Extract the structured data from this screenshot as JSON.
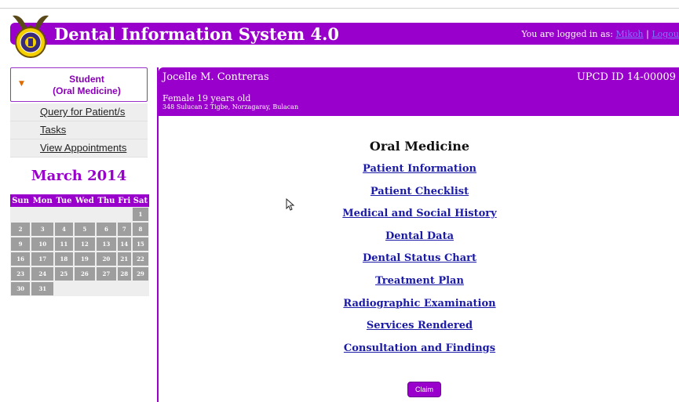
{
  "app": {
    "title": "Dental Information System 4.0"
  },
  "login": {
    "label": "You are logged in as:",
    "user": "Mikoh",
    "separator": "|",
    "logout": "Logou"
  },
  "sidebar": {
    "role": "Student",
    "department": "(Oral Medicine)",
    "menu": [
      "Query for Patient/s",
      "Tasks",
      "View Appointments"
    ]
  },
  "calendar": {
    "month": "March 2014",
    "days": [
      "Sun",
      "Mon",
      "Tue",
      "Wed",
      "Thu",
      "Fri",
      "Sat"
    ],
    "weeks": [
      [
        "",
        "",
        "",
        "",
        "",
        "",
        "1"
      ],
      [
        "2",
        "3",
        "4",
        "5",
        "6",
        "7",
        "8"
      ],
      [
        "9",
        "10",
        "11",
        "12",
        "13",
        "14",
        "15"
      ],
      [
        "16",
        "17",
        "18",
        "19",
        "20",
        "21",
        "22"
      ],
      [
        "23",
        "24",
        "25",
        "26",
        "27",
        "28",
        "29"
      ],
      [
        "30",
        "31",
        "",
        "",
        "",
        "",
        ""
      ]
    ]
  },
  "patient": {
    "name": "Jocelle M. Contreras",
    "id": "UPCD ID 14-00009",
    "info": "Female 19 years old",
    "address": "348 Sulucan 2 Tigbe, Norzagaray, Bulacan"
  },
  "main": {
    "title": "Oral Medicine",
    "links": [
      "Patient Information",
      "Patient Checklist",
      "Medical and Social History",
      "Dental Data",
      "Dental Status Chart",
      "Treatment Plan",
      "Radiographic Examination",
      "Services Rendered",
      "Consultation and Findings"
    ],
    "claim": "Claim"
  },
  "colors": {
    "accent": "#9900cc",
    "link": "#1a1aa6",
    "caret": "#e06a00"
  }
}
